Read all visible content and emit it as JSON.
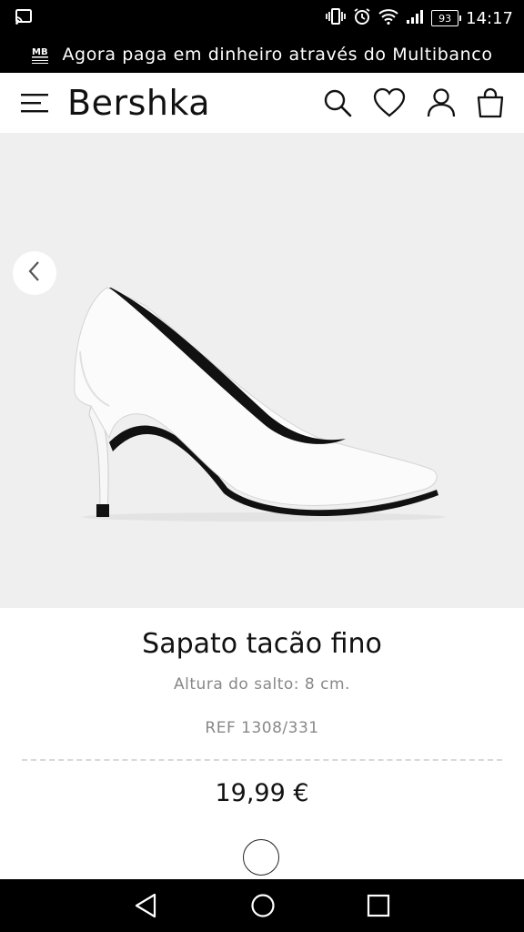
{
  "status_bar": {
    "time": "14:17",
    "battery": "93",
    "icons": [
      "cast-icon",
      "vibrate-icon",
      "alarm-icon",
      "wifi-icon",
      "signal-icon",
      "battery-icon"
    ]
  },
  "promo": {
    "text": "Agora paga em dinheiro através do Multibanco",
    "icon": "multibanco-icon"
  },
  "header": {
    "logo": "Bershka",
    "icons": [
      "menu-icon",
      "search-icon",
      "heart-icon",
      "user-icon",
      "bag-icon"
    ]
  },
  "gallery": {
    "prev_icon": "chevron-left-icon"
  },
  "product": {
    "title": "Sapato tacão fino",
    "subtitle": "Altura do salto: 8 cm.",
    "ref": "REF 1308/331",
    "price": "19,99 €",
    "color_swatch": "#ffffff"
  },
  "nav_bar": {
    "icons": [
      "back-icon",
      "home-icon",
      "recents-icon"
    ]
  },
  "colors": {
    "status_bg": "#000000",
    "gallery_bg": "#efefef",
    "text_primary": "#111111",
    "text_secondary": "#888888"
  }
}
